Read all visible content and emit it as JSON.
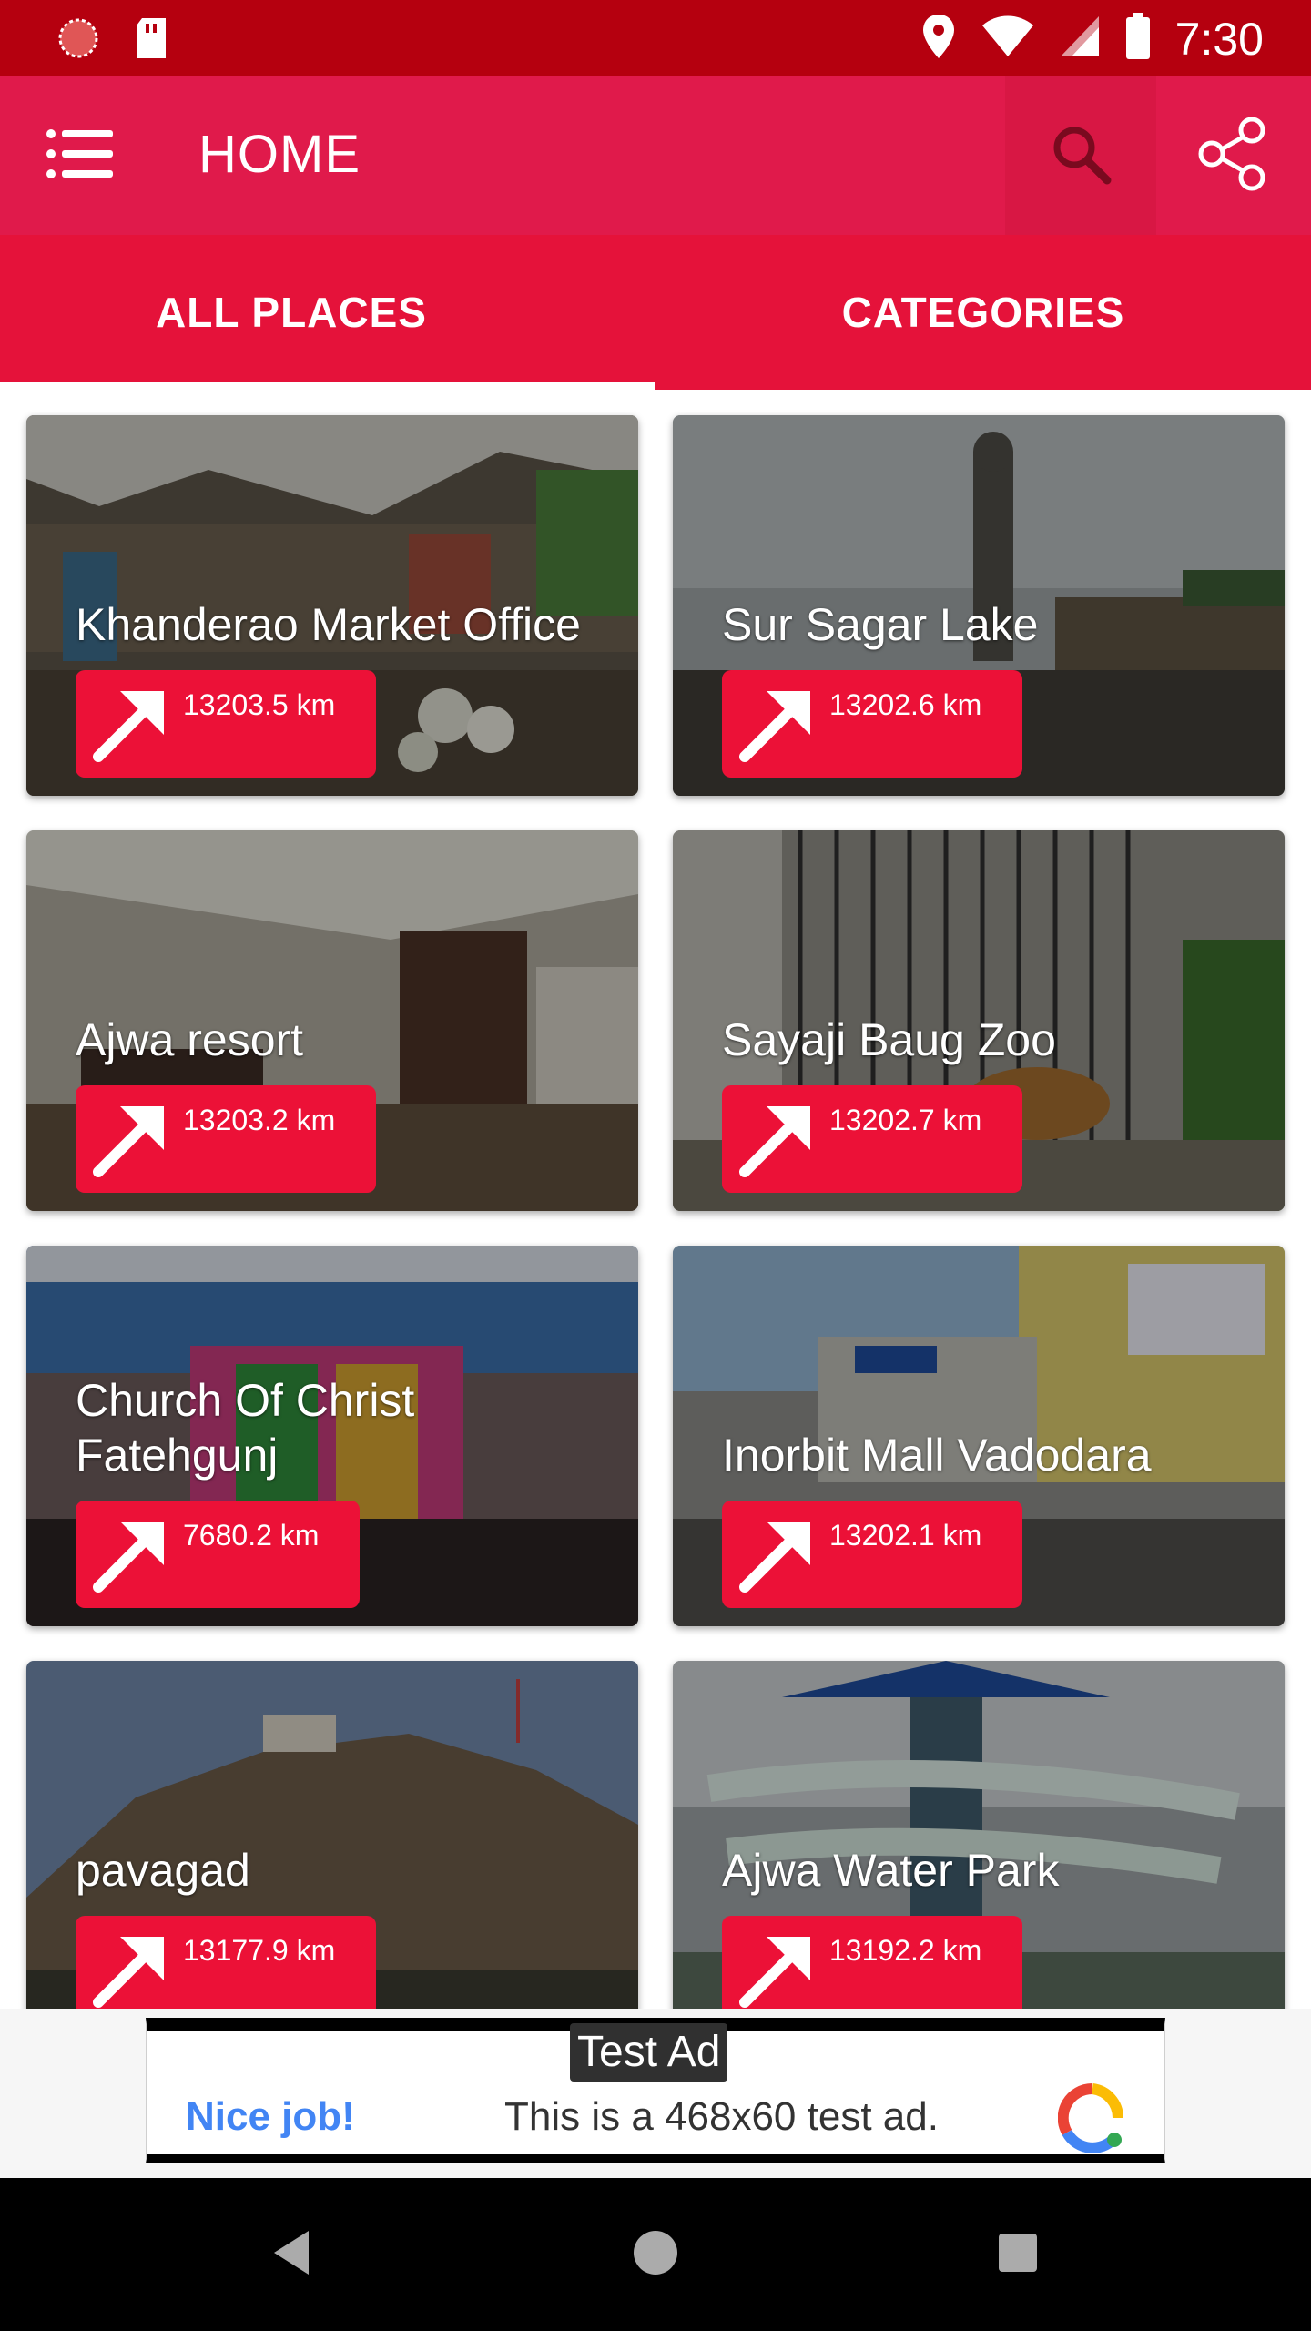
{
  "status_bar": {
    "time": "7:30",
    "icons": [
      "circle-dots-icon",
      "sd-card-icon",
      "location-pin-icon",
      "wifi-icon",
      "cell-signal-icon",
      "battery-icon"
    ]
  },
  "app_bar": {
    "title": "HOME",
    "menu_icon": "list-menu-icon",
    "search_icon": "search-icon",
    "share_icon": "share-icon"
  },
  "tabs": [
    {
      "label": "ALL PLACES",
      "selected": true
    },
    {
      "label": "CATEGORIES",
      "selected": false
    }
  ],
  "places": [
    {
      "name": "Khanderao Market Office",
      "distance": "13203.5 km"
    },
    {
      "name": "Sur Sagar Lake",
      "distance": "13202.6 km"
    },
    {
      "name": "Ajwa resort",
      "distance": "13203.2 km"
    },
    {
      "name": "Sayaji Baug Zoo",
      "distance": "13202.7 km"
    },
    {
      "name": "Church Of Christ Fatehgunj",
      "distance": "7680.2 km"
    },
    {
      "name": "Inorbit Mall Vadodara",
      "distance": "13202.1 km"
    },
    {
      "name": "pavagad",
      "distance": "13177.9 km"
    },
    {
      "name": "Ajwa Water Park",
      "distance": "13192.2 km"
    }
  ],
  "ad": {
    "label": "Test Ad",
    "headline": "Nice job!",
    "body": "This is a 468x60 test ad."
  },
  "colors": {
    "status_bar": "#b5000f",
    "app_bar": "#e01a4b",
    "tab_bar": "#e5123a",
    "distance_button": "#ec1137"
  }
}
